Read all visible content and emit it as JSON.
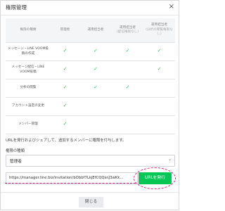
{
  "dialog": {
    "title": "権限管理",
    "close_icon": "×"
  },
  "table": {
    "headers": [
      {
        "label": "権限の種類",
        "sub": ""
      },
      {
        "label": "管理者",
        "sub": ""
      },
      {
        "label": "運用担当者",
        "sub": ""
      },
      {
        "label": "運用担当者",
        "sub": "(配信権限なし)"
      },
      {
        "label": "運用担当者",
        "sub": "(分析の閲覧権限なし)"
      }
    ],
    "rows": [
      {
        "label": "メッセージ・LINE VOOM投稿の作成",
        "checks": [
          true,
          true,
          true,
          true
        ]
      },
      {
        "label": "メッセージ配信・LINE VOOM投稿",
        "checks": [
          true,
          true,
          false,
          true
        ]
      },
      {
        "label": "分析の閲覧",
        "checks": [
          true,
          true,
          true,
          false
        ]
      },
      {
        "label": "アカウント設定の変更",
        "checks": [
          true,
          false,
          false,
          false
        ]
      },
      {
        "label": "メンバー管理",
        "checks": [
          true,
          false,
          false,
          false
        ]
      }
    ],
    "check_glyph": "✓"
  },
  "description": "URLを発行およびシェアして、追加するメンバーに権限を付与します。",
  "role_select": {
    "label": "権限の種類",
    "value": "管理者",
    "chevron": "⌄"
  },
  "url_field": {
    "value": "https://manager.line.biz/invitation/bObbf7LkjEfCQQsnJ3wKk..."
  },
  "issue_button": {
    "label": "URLを発行"
  },
  "close_button": {
    "label": "閉じる"
  },
  "colors": {
    "accent_green": "#06c755",
    "highlight_pink": "#e6287d"
  }
}
